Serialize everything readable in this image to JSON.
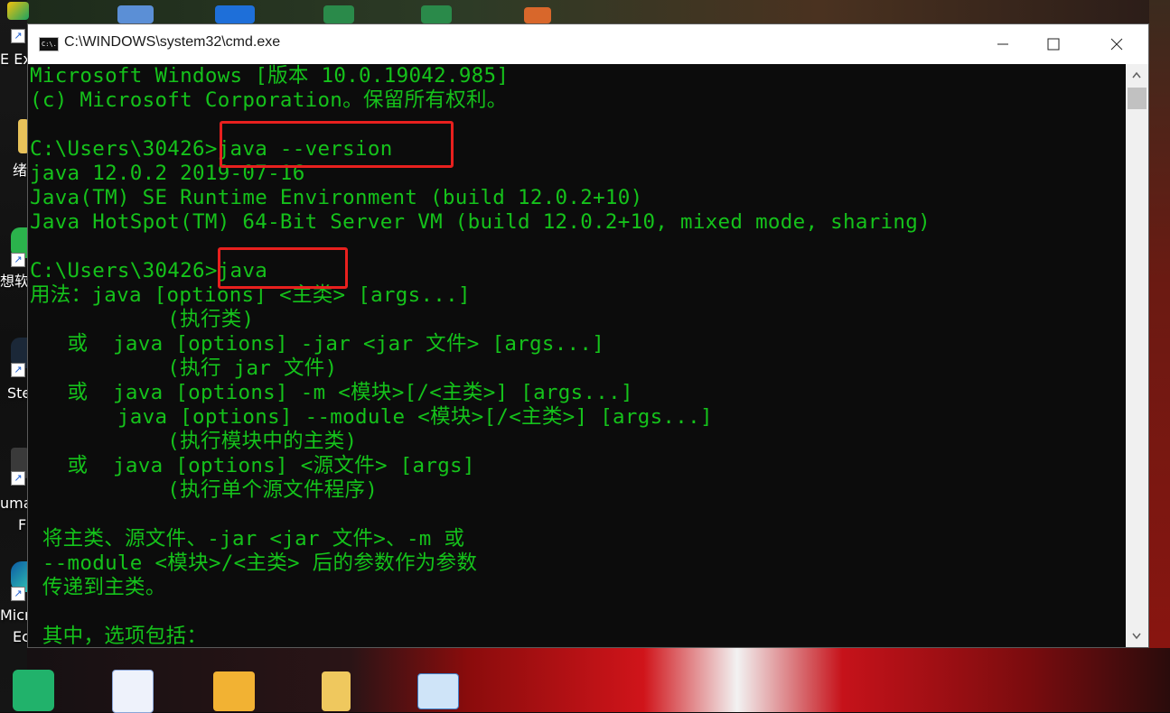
{
  "window": {
    "title": "C:\\WINDOWS\\system32\\cmd.exe",
    "icon_text": "C:\\."
  },
  "console_lines": [
    "Microsoft Windows [版本 10.0.19042.985]",
    "(c) Microsoft Corporation。保留所有权利。",
    "",
    "C:\\Users\\30426>java --version",
    "java 12.0.2 2019-07-16",
    "Java(TM) SE Runtime Environment (build 12.0.2+10)",
    "Java HotSpot(TM) 64-Bit Server VM (build 12.0.2+10, mixed mode, sharing)",
    "",
    "C:\\Users\\30426>java",
    "用法：java [options] <主类> [args...]",
    "           (执行类)",
    "   或  java [options] -jar <jar 文件> [args...]",
    "           (执行 jar 文件)",
    "   或  java [options] -m <模块>[/<主类>] [args...]",
    "       java [options] --module <模块>[/<主类>] [args...]",
    "           (执行模块中的主类)",
    "   或  java [options] <源文件> [args]",
    "           (执行单个源文件程序)",
    "",
    " 将主类、源文件、-jar <jar 文件>、-m 或",
    " --module <模块>/<主类> 后的参数作为参数",
    " 传递到主类。",
    "",
    " 其中，选项包括："
  ],
  "desktop_labels": {
    "e_ex": "E Ex",
    "xu": "绪",
    "xiang": "想软",
    "ste": "Ste",
    "uma": "uma",
    "f": "F",
    "micr": "Micr",
    "ed": "Ec"
  },
  "colors": {
    "console_text": "#15c21b",
    "console_bg": "#0c0c0c",
    "highlight": "#e8201e"
  },
  "icons": {
    "window_icon": "cmd-icon",
    "minimize": "minimize-icon",
    "maximize": "maximize-icon",
    "close": "close-icon"
  }
}
